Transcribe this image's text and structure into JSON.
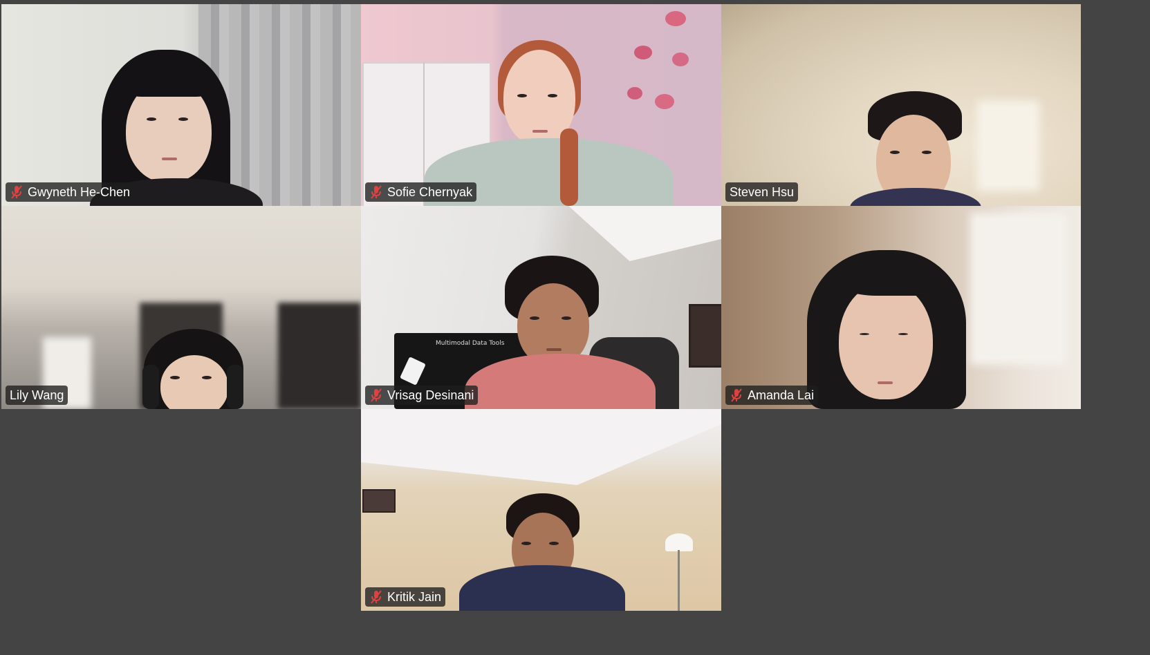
{
  "window": {
    "accent_color": "#23d18b",
    "tag_background": "#1e1e1ec7"
  },
  "participants": [
    {
      "name": "Gwyneth He-Chen",
      "muted": true,
      "speaking": false
    },
    {
      "name": "Sofie Chernyak",
      "muted": true,
      "speaking": false
    },
    {
      "name": "Steven Hsu",
      "muted": false,
      "speaking": false
    },
    {
      "name": "Lily Wang",
      "muted": false,
      "speaking": true
    },
    {
      "name": "Vrisag Desinani",
      "muted": true,
      "speaking": false
    },
    {
      "name": "Amanda Lai",
      "muted": true,
      "speaking": false
    },
    {
      "name": "Kritik Jain",
      "muted": true,
      "speaking": false
    }
  ],
  "icons": {
    "muted": "muted-mic-icon"
  },
  "whiteboard": {
    "heading": "Multimodal Data Tools"
  }
}
